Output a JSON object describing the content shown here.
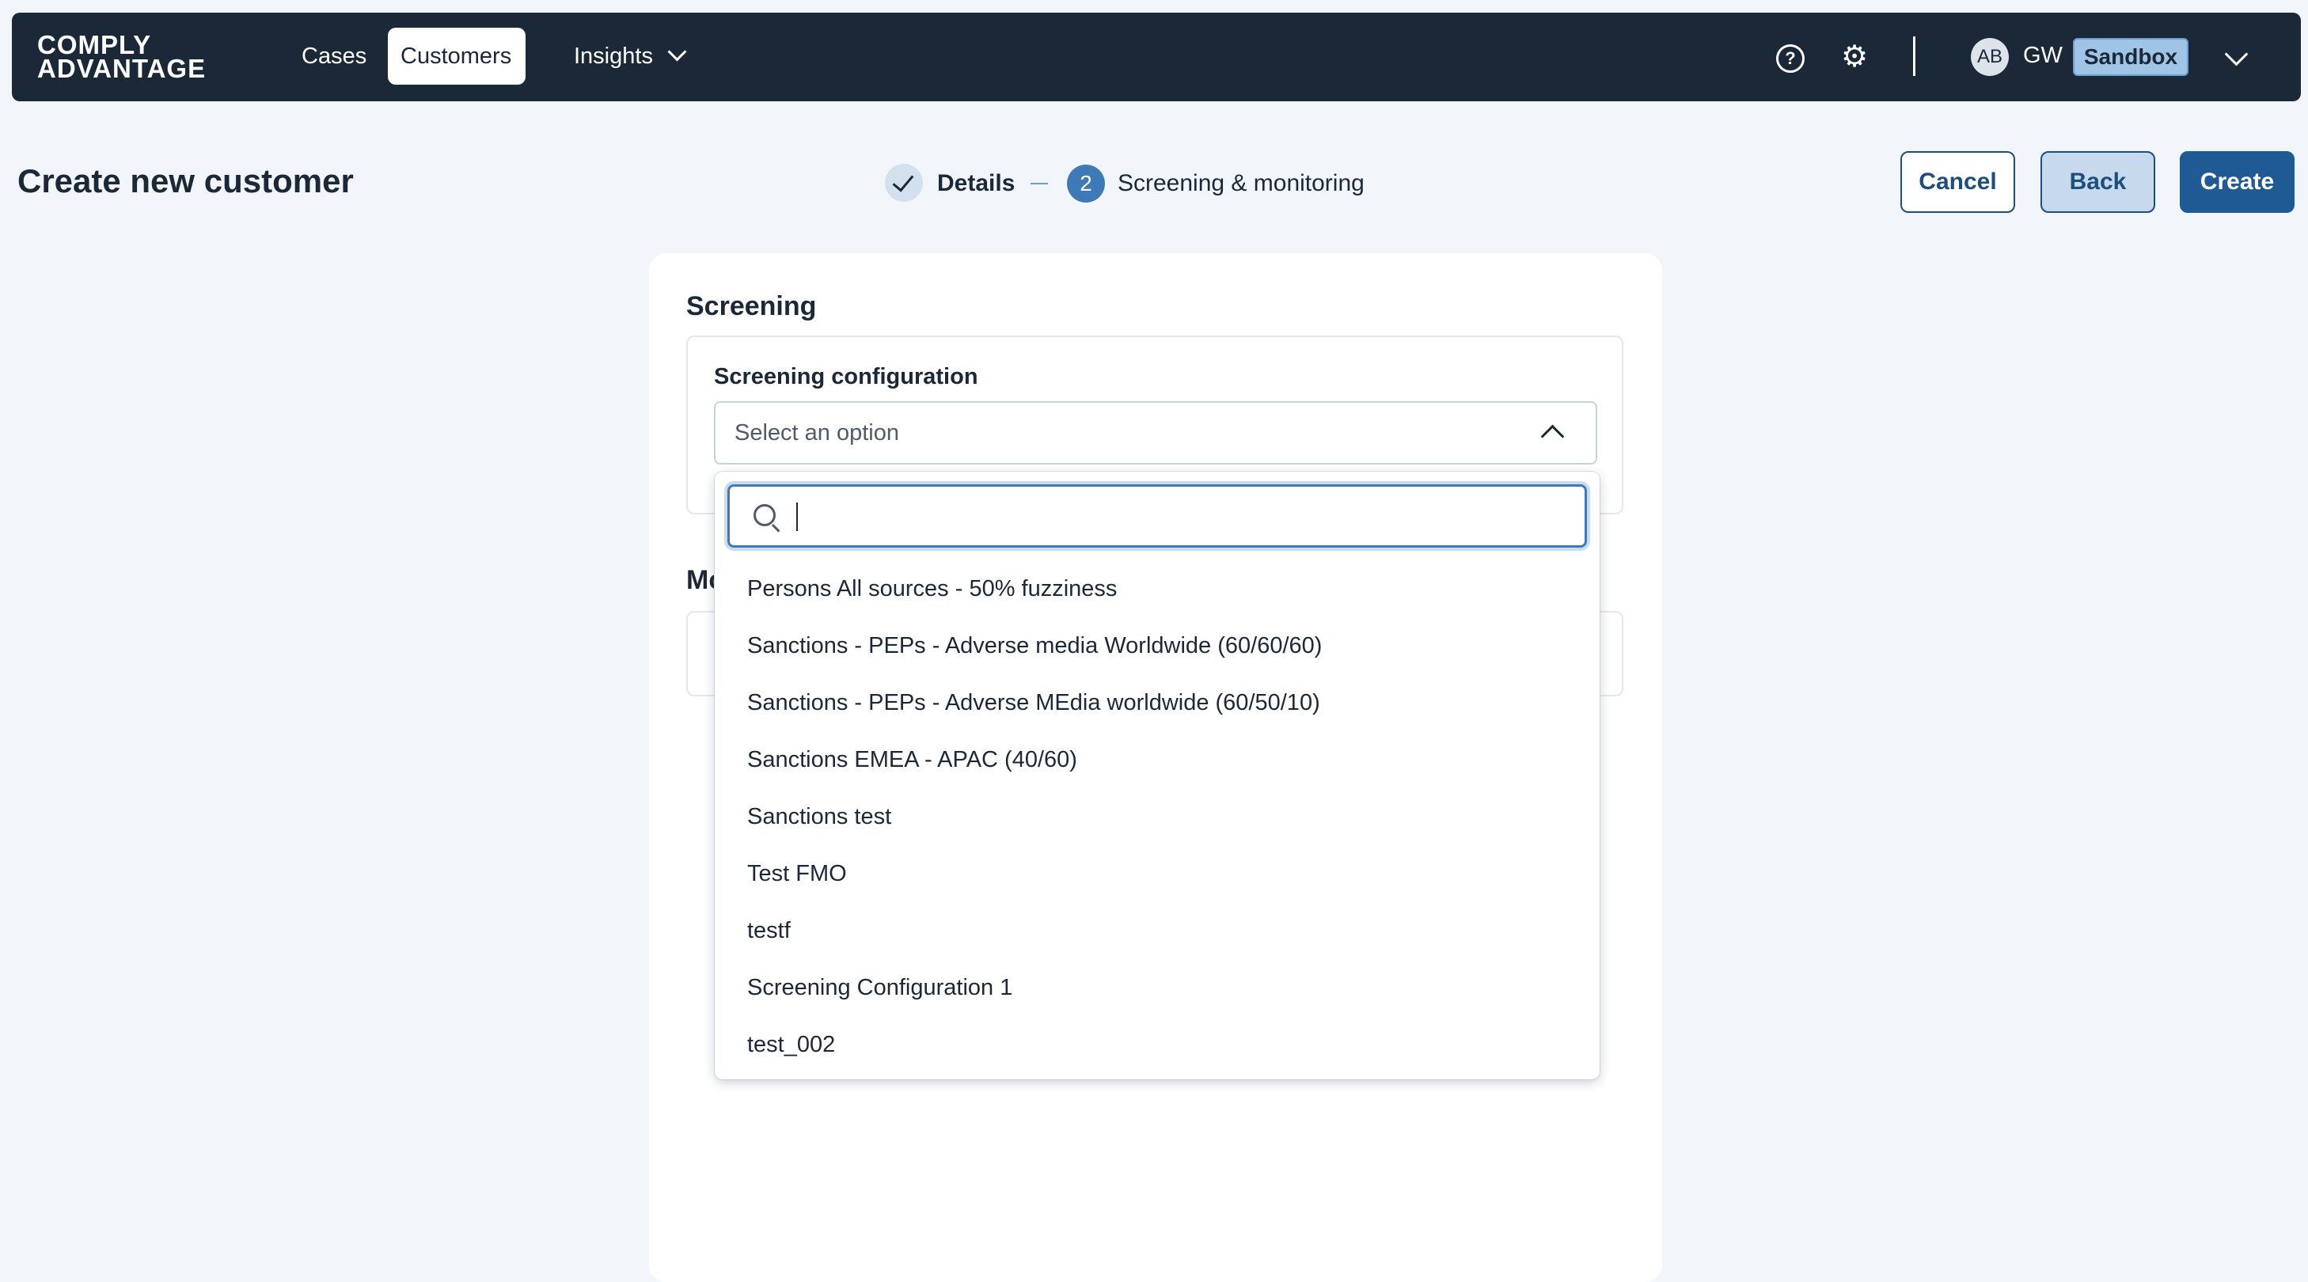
{
  "nav": {
    "logo_line1": "COMPLY",
    "logo_line2": "ADVANTAGE",
    "items": [
      {
        "label": "Cases"
      },
      {
        "label": "Customers"
      },
      {
        "label": "Insights"
      }
    ],
    "help_symbol": "?",
    "gear_symbol": "⚙",
    "avatar_initials": "AB",
    "user_initials": "GW",
    "environment": "Sandbox"
  },
  "page": {
    "title": "Create new customer",
    "steps": [
      {
        "label": "Details",
        "status": "done"
      },
      {
        "number": "2",
        "label": "Screening & monitoring",
        "status": "current"
      }
    ],
    "buttons": {
      "cancel": "Cancel",
      "back": "Back",
      "create": "Create"
    }
  },
  "screening": {
    "section_title": "Screening",
    "field_label": "Screening configuration",
    "placeholder": "Select an option",
    "search_value": "",
    "options": [
      "Persons All sources - 50% fuzziness",
      "Sanctions - PEPs - Adverse media Worldwide (60/60/60)",
      "Sanctions - PEPs - Adverse MEdia worldwide (60/50/10)",
      "Sanctions EMEA - APAC (40/60)",
      "Sanctions test",
      "Test FMO",
      "testf",
      "Screening Configuration 1",
      "test_002"
    ]
  },
  "monitoring": {
    "section_title_partial": "Mo"
  },
  "colors": {
    "nav_bg": "#1b2838",
    "page_bg": "#f2f5f9",
    "accent": "#1f5a94",
    "step_current": "#3e7ab8",
    "badge_bg": "#9fc4e6"
  }
}
